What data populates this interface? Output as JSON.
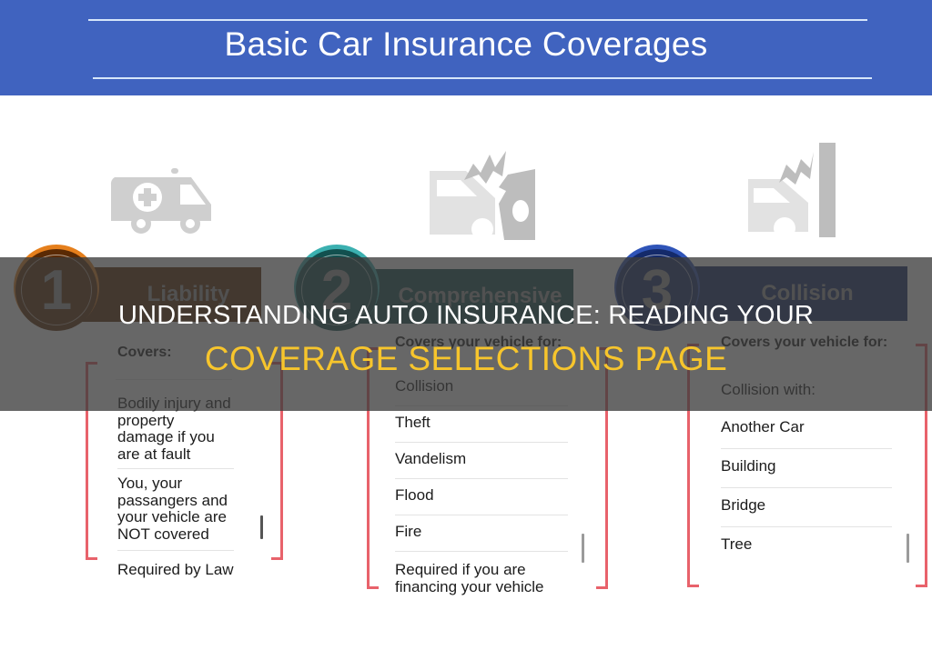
{
  "header": {
    "title": "Basic Car Insurance Coverages"
  },
  "icons": [
    {
      "name": "ambulance-icon"
    },
    {
      "name": "car-crash-icon"
    },
    {
      "name": "car-wall-collision-icon"
    }
  ],
  "coverages": [
    {
      "number": "1",
      "label": "Liability",
      "color": "#5a2a04",
      "ring_color": "#e57f1c",
      "heading": "Covers:",
      "items": [
        "Bodily injury and property damage if you are at fault",
        "You, your passangers and your vehicle are NOT covered",
        "Required by Law"
      ]
    },
    {
      "number": "2",
      "label": "Comprehensive",
      "color": "#12504f",
      "ring_color": "#3bb0b0",
      "heading": "Covers your vehicle for:",
      "items": [
        "Collision",
        "Theft",
        "Vandelism",
        "Flood",
        "Fire",
        "Required if you are financing your vehicle"
      ]
    },
    {
      "number": "3",
      "label": "Collision",
      "color": "#142a6a",
      "ring_color": "#2f54b8",
      "heading": "Covers your vehicle for:",
      "items": [
        "Collision with:",
        "Another Car",
        "Building",
        "Bridge",
        "Tree"
      ]
    }
  ],
  "overlay": {
    "line1": "UNDERSTANDING AUTO INSURANCE: READING YOUR",
    "line2": "COVERAGE SELECTIONS PAGE",
    "line1_color": "#ffffff",
    "line2_color": "#f7c52c"
  }
}
